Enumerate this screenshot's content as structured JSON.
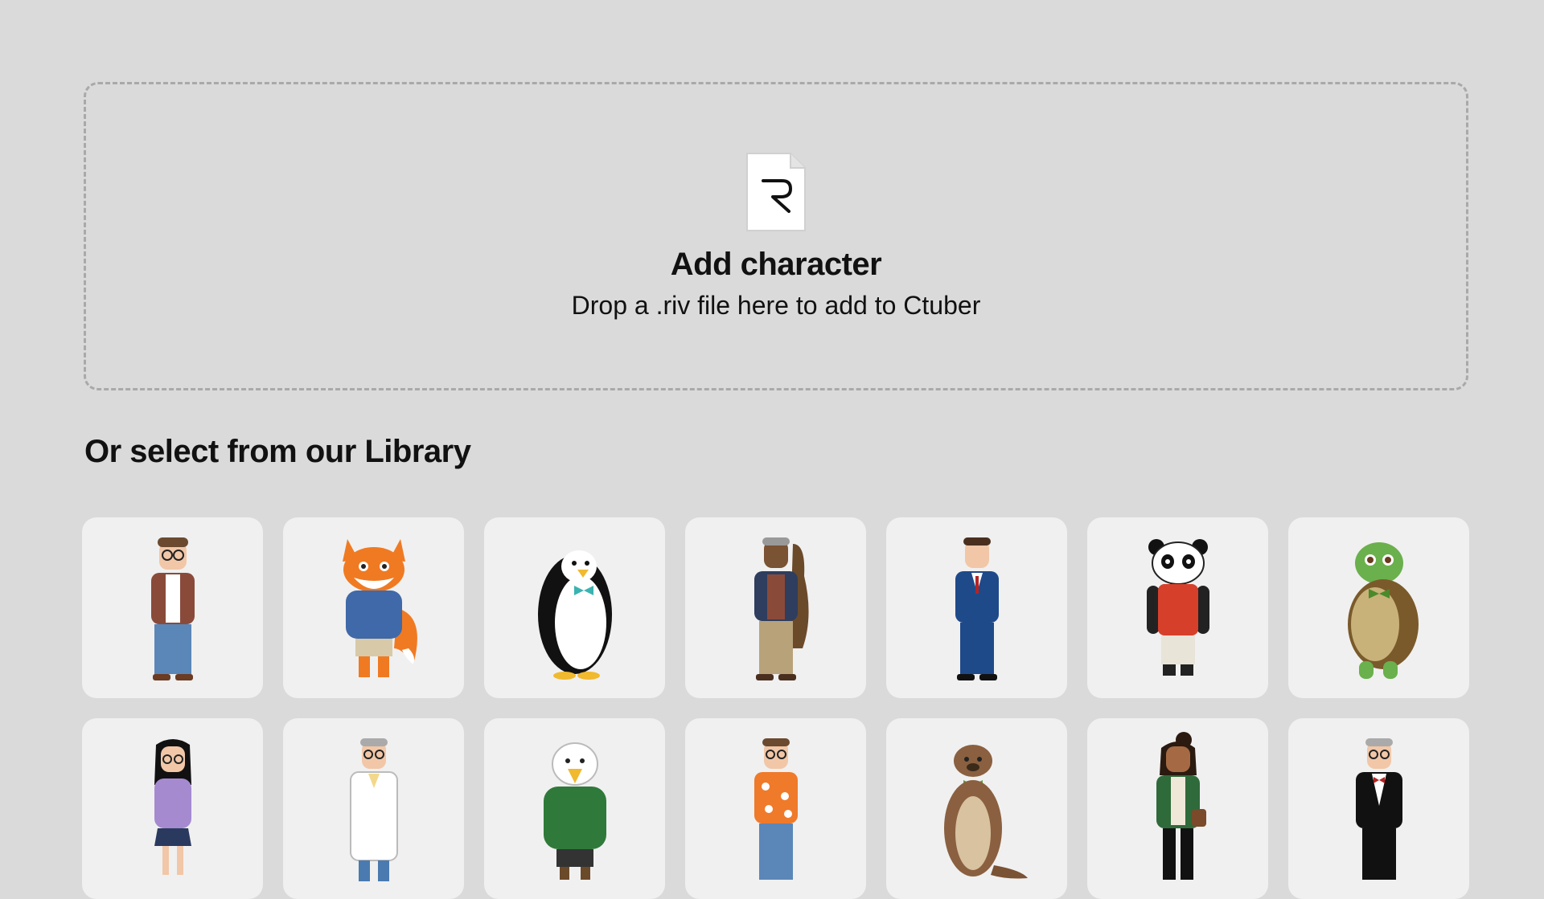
{
  "dropzone": {
    "icon": "rive-file-icon",
    "title": "Add character",
    "subtitle": "Drop a .riv file here to add to Ctuber"
  },
  "library": {
    "title": "Or select from our Library",
    "characters": [
      {
        "id": "man-brown-jacket",
        "icon": "character-man-brown-jacket"
      },
      {
        "id": "fox-hoodie",
        "icon": "character-fox-hoodie"
      },
      {
        "id": "penguin",
        "icon": "character-penguin"
      },
      {
        "id": "man-guitar-case",
        "icon": "character-man-guitar-case"
      },
      {
        "id": "man-blue-suit",
        "icon": "character-man-blue-suit"
      },
      {
        "id": "panda",
        "icon": "character-panda"
      },
      {
        "id": "turtle",
        "icon": "character-turtle"
      },
      {
        "id": "girl-purple-hoodie",
        "icon": "character-girl-purple-hoodie"
      },
      {
        "id": "doctor",
        "icon": "character-doctor"
      },
      {
        "id": "eagle-hoodie",
        "icon": "character-eagle-hoodie"
      },
      {
        "id": "man-hawaiian-shirt",
        "icon": "character-man-hawaiian-shirt"
      },
      {
        "id": "otter",
        "icon": "character-otter"
      },
      {
        "id": "woman-green-jacket",
        "icon": "character-woman-green-jacket"
      },
      {
        "id": "man-tuxedo",
        "icon": "character-man-tuxedo"
      }
    ]
  },
  "colors": {
    "background": "#dadada",
    "card": "#f0f0f0",
    "dash": "#a9a9a9"
  }
}
